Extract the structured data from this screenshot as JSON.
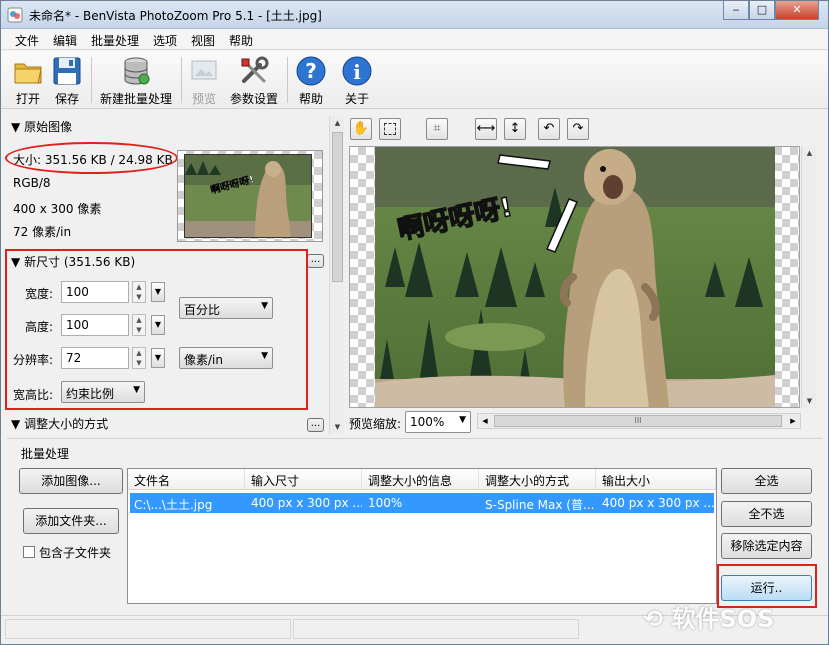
{
  "title": "未命名* - BenVista PhotoZoom Pro 5.1 - [土土.jpg]",
  "window_buttons": {
    "minimize": "‒",
    "maximize": "□",
    "close": "✕"
  },
  "menu": [
    "文件",
    "编辑",
    "批量处理",
    "选项",
    "视图",
    "帮助"
  ],
  "toolbar": {
    "open": "打开",
    "save": "保存",
    "new_batch": "新建批量处理",
    "preview": "预览",
    "settings": "参数设置",
    "help": "帮助",
    "about": "关于"
  },
  "original": {
    "header": "原始图像",
    "size": "大小: 351.56 KB / 24.98 KB",
    "mode": "RGB/8",
    "dimensions": "400 x 300 像素",
    "resolution": "72 像素/in",
    "thumb_text": "啊呀呀呀!"
  },
  "new_size": {
    "header": "新尺寸 (351.56 KB)",
    "width_label": "宽度:",
    "width_value": "100",
    "height_label": "高度:",
    "height_value": "100",
    "resolution_label": "分辨率:",
    "resolution_value": "72",
    "unit_percent": "百分比",
    "unit_ppi": "像素/in",
    "aspect_label": "宽高比:",
    "aspect_value": "约束比例"
  },
  "resize_method": {
    "header": "调整大小的方式"
  },
  "more_button": "...",
  "preview": {
    "image_text": "啊呀呀呀!",
    "zoom_label": "预览缩放:",
    "zoom_value": "100%",
    "scroll_grip": "III"
  },
  "batch": {
    "header": "批量处理",
    "add_images": "添加图像...",
    "add_folder": "添加文件夹...",
    "include_subfolders": "包含子文件夹",
    "columns": [
      "文件名",
      "输入尺寸",
      "调整大小的信息",
      "调整大小的方式",
      "输出大小"
    ],
    "rows": [
      [
        "C:\\...\\土土.jpg",
        "400 px x 300 px ...",
        "100%",
        "S-Spline Max (普...",
        "400 px x 300 px ..."
      ]
    ],
    "select_all": "全选",
    "select_none": "全不选",
    "remove_selected": "移除选定内容",
    "run": "运行.."
  },
  "watermark": "软件SOS",
  "colors": {
    "selection": "#3399ff",
    "highlight_red": "#e0201c"
  }
}
